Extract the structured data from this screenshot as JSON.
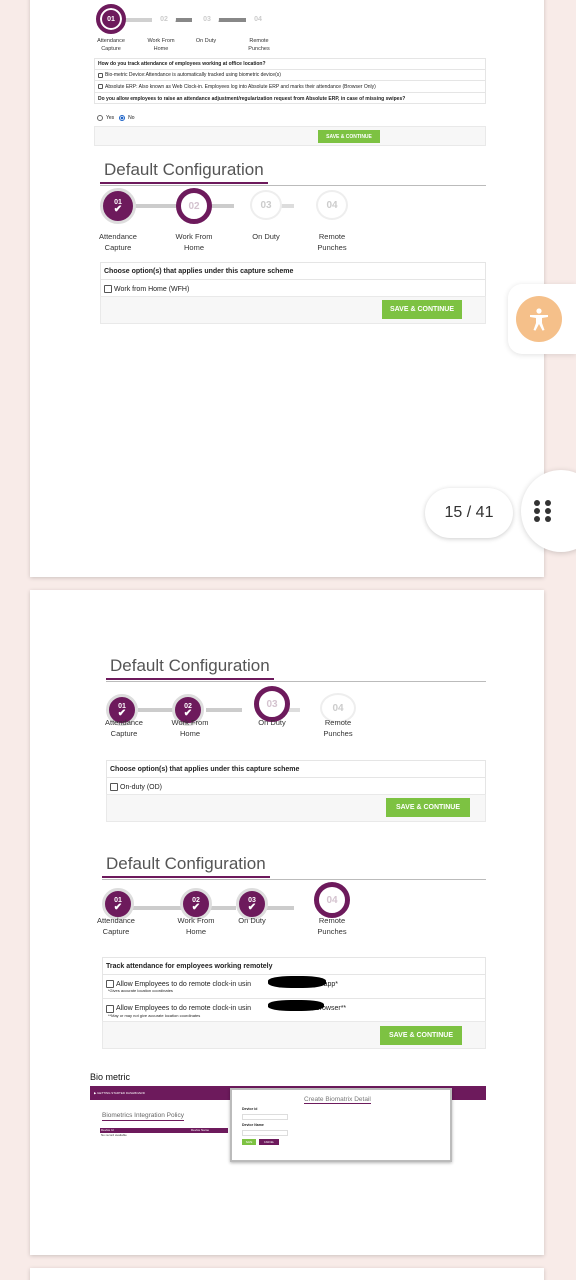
{
  "wizard_top": {
    "steps": [
      {
        "num": "01",
        "label_line1": "Attendance",
        "label_line2": "Capture"
      },
      {
        "num": "02",
        "label_line1": "Work From",
        "label_line2": "Home"
      },
      {
        "num": "03",
        "label_line1": "On Duty",
        "label_line2": ""
      },
      {
        "num": "04",
        "label_line1": "Remote",
        "label_line2": "Punches"
      }
    ],
    "question1": "How do you track attendance of employees working at office location?",
    "option_biometric": "Bio-metric Device:Attendance is automatically tracked using biometric device(s)",
    "option_erp": "Absolute ERP: Also known as Web Clock-in. Employees log into Absolute ERP and marks their attendance (Browser Only)",
    "question2": "Do you allow employees to raise an attendance adjustment/regularization request from Absolute ERP, in case of missing swipes?",
    "radio_yes": "Yes",
    "radio_no": "No",
    "save_label": "SAVE & CONTINUE"
  },
  "config_wfh": {
    "title": "Default Configuration",
    "steps": [
      {
        "num": "01",
        "label_line1": "Attendance",
        "label_line2": "Capture"
      },
      {
        "num": "02",
        "label_line1": "Work From",
        "label_line2": "Home"
      },
      {
        "num": "03",
        "label_line1": "On Duty",
        "label_line2": ""
      },
      {
        "num": "04",
        "label_line1": "Remote",
        "label_line2": "Punches"
      }
    ],
    "heading": "Choose option(s) that applies under this capture scheme",
    "option": "Work from Home (WFH)",
    "save_label": "SAVE & CONTINUE"
  },
  "config_od": {
    "title": "Default Configuration",
    "steps": [
      {
        "num": "01",
        "label_line1": "Attendance",
        "label_line2": "Capture"
      },
      {
        "num": "02",
        "label_line1": "Work From",
        "label_line2": "Home"
      },
      {
        "num": "03",
        "label_line1": "On Duty",
        "label_line2": ""
      },
      {
        "num": "04",
        "label_line1": "Remote",
        "label_line2": "Punches"
      }
    ],
    "heading": "Choose option(s) that applies under this capture scheme",
    "option": "On-duty (OD)",
    "save_label": "SAVE & CONTINUE"
  },
  "config_remote": {
    "title": "Default Configuration",
    "steps": [
      {
        "num": "01",
        "label_line1": "Attendance",
        "label_line2": "Capture"
      },
      {
        "num": "02",
        "label_line1": "Work From",
        "label_line2": "Home"
      },
      {
        "num": "03",
        "label_line1": "On Duty",
        "label_line2": ""
      },
      {
        "num": "04",
        "label_line1": "Remote",
        "label_line2": "Punches"
      }
    ],
    "heading": "Track attendance for employees working remotely",
    "option1_prefix": "Allow Employees to do remote clock-in usin",
    "option1_suffix": "mobile app*",
    "option1_note": "*Gives accurate location coordinates",
    "option2_prefix": "Allow Employees to do remote clock-in usin",
    "option2_suffix": "web browser**",
    "option2_note": "**May or may not give accurate location coordinates",
    "save_label": "SAVE & CONTINUE"
  },
  "biometric": {
    "title": "Bio metric",
    "bar_text": "▶ GETTING STARTED DASHBOARD",
    "policy_title": "Biometrics Integration Policy",
    "col_device_id": "Device Id",
    "col_device_name": "Device Name",
    "empty": "No record available",
    "dialog_title": "Create Biomatrix Detail",
    "field_device_id": "Device id",
    "field_device_name": "Device Name",
    "save": "SAVE",
    "cancel": "CANCEL"
  },
  "viewer": {
    "page_indicator": "15 / 41"
  },
  "colors": {
    "brand_purple": "#6d1a5c",
    "save_green": "#7dc242",
    "accessibility_orange": "#f5c08a",
    "background": "#f8ebe8"
  },
  "icons": [
    "check-icon",
    "accessibility-icon",
    "more-grid-icon"
  ]
}
